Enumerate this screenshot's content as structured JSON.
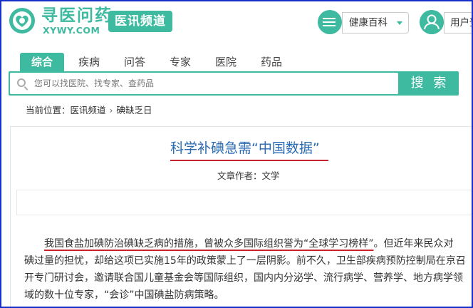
{
  "header": {
    "logo_cn": "寻医问药",
    "logo_en": "XYWY.COM",
    "channel": "医讯频道",
    "health_dropdown": "健康百科",
    "user_label": "用户登录"
  },
  "nav": {
    "tabs": [
      {
        "label": "综合",
        "active": true
      },
      {
        "label": "疾病",
        "active": false
      },
      {
        "label": "问答",
        "active": false
      },
      {
        "label": "专家",
        "active": false
      },
      {
        "label": "医院",
        "active": false
      },
      {
        "label": "药品",
        "active": false
      }
    ]
  },
  "search": {
    "placeholder": "您可以找医院、找专家、查药品",
    "button": "搜 索"
  },
  "breadcrumb": {
    "prefix": "当前位置：",
    "items": [
      "医讯频道",
      "碘缺乏日"
    ]
  },
  "article": {
    "title": "科学补碘急需“中国数据”",
    "author_label": "文章作者：",
    "author": "文学",
    "para_underlined": "我国食盐加碘防治碘缺乏病的措施，曾被众多国际组织誉为“全球学习榜样”",
    "para_line1_rest": "。但近年来民众对",
    "para_line2": "碘过量的担忧，却给这项已实施15年的政策蒙上了一层阴影。前不久，卫生部疾病预防控制局在京召",
    "para_line3": "开专门研讨会，邀请联合国儿童基金会等国际组织，国内内分泌学、流行病学、营养学、地方病学领",
    "para_line4": "域的数十位专家，“会诊”中国碘盐防病策略。"
  },
  "colors": {
    "brand": "#3dba9f",
    "title_blue": "#2a6bb3",
    "underline_red": "#c8232c",
    "frame_blue": "#1530c8"
  }
}
